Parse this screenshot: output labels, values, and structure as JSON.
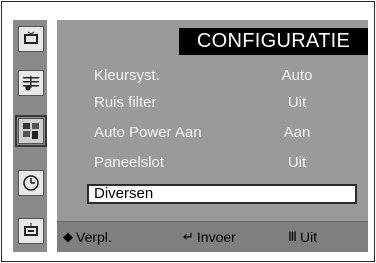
{
  "menu": {
    "title": "CONFIGURATIE",
    "rows": [
      {
        "label": "Kleursyst.",
        "value": "Auto"
      },
      {
        "label": "Ruis filter",
        "value": "Uit"
      },
      {
        "label": "Auto Power Aan",
        "value": "Aan"
      },
      {
        "label": "Paneelslot",
        "value": "Uit"
      }
    ],
    "selected_row": {
      "label": "Diversen"
    }
  },
  "sidebar": {
    "icons": [
      "tv-picture-icon",
      "music-note-icon",
      "hand-setup-icon",
      "clock-icon",
      "tv-input-icon"
    ],
    "active_index": 2
  },
  "footer": {
    "move": {
      "glyph": "◆",
      "label": "Verpl."
    },
    "enter": {
      "glyph": "↵",
      "label": "Invoer"
    },
    "exit": {
      "glyph": "Ⅲ",
      "label": "Uit"
    }
  }
}
